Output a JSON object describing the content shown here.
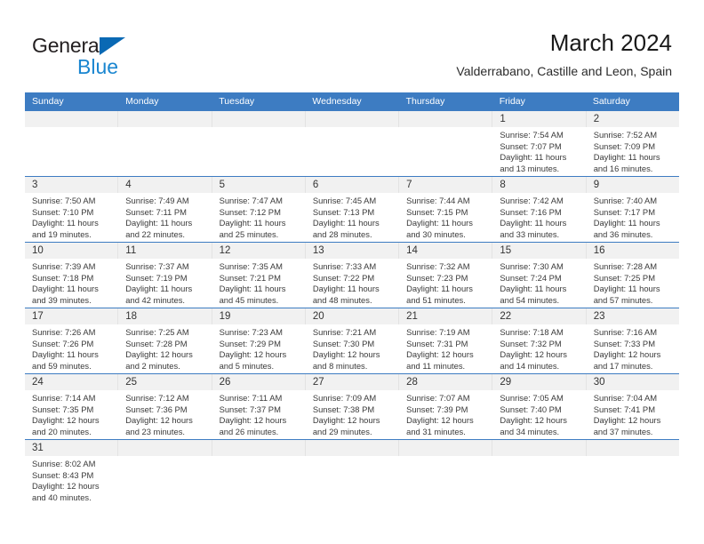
{
  "brand": {
    "name_top": "General",
    "name_bottom": "Blue",
    "color_dark": "#231f20",
    "color_blue": "#1a86d0",
    "triangle_color": "#0a69b4"
  },
  "header": {
    "title": "March 2024",
    "subtitle": "Valderrabano, Castille and Leon, Spain"
  },
  "theme": {
    "header_bar_color": "#3d7cc2",
    "daynum_band_color": "#f1f1f1",
    "row_rule_color": "#3d7cc2",
    "text_color": "#3a3a3a"
  },
  "weekdays": [
    "Sunday",
    "Monday",
    "Tuesday",
    "Wednesday",
    "Thursday",
    "Friday",
    "Saturday"
  ],
  "weeks": [
    [
      {
        "day": "",
        "lines": [
          "",
          "",
          "",
          ""
        ]
      },
      {
        "day": "",
        "lines": [
          "",
          "",
          "",
          ""
        ]
      },
      {
        "day": "",
        "lines": [
          "",
          "",
          "",
          ""
        ]
      },
      {
        "day": "",
        "lines": [
          "",
          "",
          "",
          ""
        ]
      },
      {
        "day": "",
        "lines": [
          "",
          "",
          "",
          ""
        ]
      },
      {
        "day": "1",
        "lines": [
          "Sunrise: 7:54 AM",
          "Sunset: 7:07 PM",
          "Daylight: 11 hours",
          "and 13 minutes."
        ]
      },
      {
        "day": "2",
        "lines": [
          "Sunrise: 7:52 AM",
          "Sunset: 7:09 PM",
          "Daylight: 11 hours",
          "and 16 minutes."
        ]
      }
    ],
    [
      {
        "day": "3",
        "lines": [
          "Sunrise: 7:50 AM",
          "Sunset: 7:10 PM",
          "Daylight: 11 hours",
          "and 19 minutes."
        ]
      },
      {
        "day": "4",
        "lines": [
          "Sunrise: 7:49 AM",
          "Sunset: 7:11 PM",
          "Daylight: 11 hours",
          "and 22 minutes."
        ]
      },
      {
        "day": "5",
        "lines": [
          "Sunrise: 7:47 AM",
          "Sunset: 7:12 PM",
          "Daylight: 11 hours",
          "and 25 minutes."
        ]
      },
      {
        "day": "6",
        "lines": [
          "Sunrise: 7:45 AM",
          "Sunset: 7:13 PM",
          "Daylight: 11 hours",
          "and 28 minutes."
        ]
      },
      {
        "day": "7",
        "lines": [
          "Sunrise: 7:44 AM",
          "Sunset: 7:15 PM",
          "Daylight: 11 hours",
          "and 30 minutes."
        ]
      },
      {
        "day": "8",
        "lines": [
          "Sunrise: 7:42 AM",
          "Sunset: 7:16 PM",
          "Daylight: 11 hours",
          "and 33 minutes."
        ]
      },
      {
        "day": "9",
        "lines": [
          "Sunrise: 7:40 AM",
          "Sunset: 7:17 PM",
          "Daylight: 11 hours",
          "and 36 minutes."
        ]
      }
    ],
    [
      {
        "day": "10",
        "lines": [
          "Sunrise: 7:39 AM",
          "Sunset: 7:18 PM",
          "Daylight: 11 hours",
          "and 39 minutes."
        ]
      },
      {
        "day": "11",
        "lines": [
          "Sunrise: 7:37 AM",
          "Sunset: 7:19 PM",
          "Daylight: 11 hours",
          "and 42 minutes."
        ]
      },
      {
        "day": "12",
        "lines": [
          "Sunrise: 7:35 AM",
          "Sunset: 7:21 PM",
          "Daylight: 11 hours",
          "and 45 minutes."
        ]
      },
      {
        "day": "13",
        "lines": [
          "Sunrise: 7:33 AM",
          "Sunset: 7:22 PM",
          "Daylight: 11 hours",
          "and 48 minutes."
        ]
      },
      {
        "day": "14",
        "lines": [
          "Sunrise: 7:32 AM",
          "Sunset: 7:23 PM",
          "Daylight: 11 hours",
          "and 51 minutes."
        ]
      },
      {
        "day": "15",
        "lines": [
          "Sunrise: 7:30 AM",
          "Sunset: 7:24 PM",
          "Daylight: 11 hours",
          "and 54 minutes."
        ]
      },
      {
        "day": "16",
        "lines": [
          "Sunrise: 7:28 AM",
          "Sunset: 7:25 PM",
          "Daylight: 11 hours",
          "and 57 minutes."
        ]
      }
    ],
    [
      {
        "day": "17",
        "lines": [
          "Sunrise: 7:26 AM",
          "Sunset: 7:26 PM",
          "Daylight: 11 hours",
          "and 59 minutes."
        ]
      },
      {
        "day": "18",
        "lines": [
          "Sunrise: 7:25 AM",
          "Sunset: 7:28 PM",
          "Daylight: 12 hours",
          "and 2 minutes."
        ]
      },
      {
        "day": "19",
        "lines": [
          "Sunrise: 7:23 AM",
          "Sunset: 7:29 PM",
          "Daylight: 12 hours",
          "and 5 minutes."
        ]
      },
      {
        "day": "20",
        "lines": [
          "Sunrise: 7:21 AM",
          "Sunset: 7:30 PM",
          "Daylight: 12 hours",
          "and 8 minutes."
        ]
      },
      {
        "day": "21",
        "lines": [
          "Sunrise: 7:19 AM",
          "Sunset: 7:31 PM",
          "Daylight: 12 hours",
          "and 11 minutes."
        ]
      },
      {
        "day": "22",
        "lines": [
          "Sunrise: 7:18 AM",
          "Sunset: 7:32 PM",
          "Daylight: 12 hours",
          "and 14 minutes."
        ]
      },
      {
        "day": "23",
        "lines": [
          "Sunrise: 7:16 AM",
          "Sunset: 7:33 PM",
          "Daylight: 12 hours",
          "and 17 minutes."
        ]
      }
    ],
    [
      {
        "day": "24",
        "lines": [
          "Sunrise: 7:14 AM",
          "Sunset: 7:35 PM",
          "Daylight: 12 hours",
          "and 20 minutes."
        ]
      },
      {
        "day": "25",
        "lines": [
          "Sunrise: 7:12 AM",
          "Sunset: 7:36 PM",
          "Daylight: 12 hours",
          "and 23 minutes."
        ]
      },
      {
        "day": "26",
        "lines": [
          "Sunrise: 7:11 AM",
          "Sunset: 7:37 PM",
          "Daylight: 12 hours",
          "and 26 minutes."
        ]
      },
      {
        "day": "27",
        "lines": [
          "Sunrise: 7:09 AM",
          "Sunset: 7:38 PM",
          "Daylight: 12 hours",
          "and 29 minutes."
        ]
      },
      {
        "day": "28",
        "lines": [
          "Sunrise: 7:07 AM",
          "Sunset: 7:39 PM",
          "Daylight: 12 hours",
          "and 31 minutes."
        ]
      },
      {
        "day": "29",
        "lines": [
          "Sunrise: 7:05 AM",
          "Sunset: 7:40 PM",
          "Daylight: 12 hours",
          "and 34 minutes."
        ]
      },
      {
        "day": "30",
        "lines": [
          "Sunrise: 7:04 AM",
          "Sunset: 7:41 PM",
          "Daylight: 12 hours",
          "and 37 minutes."
        ]
      }
    ],
    [
      {
        "day": "31",
        "lines": [
          "Sunrise: 8:02 AM",
          "Sunset: 8:43 PM",
          "Daylight: 12 hours",
          "and 40 minutes."
        ]
      },
      {
        "day": "",
        "lines": [
          "",
          "",
          "",
          ""
        ]
      },
      {
        "day": "",
        "lines": [
          "",
          "",
          "",
          ""
        ]
      },
      {
        "day": "",
        "lines": [
          "",
          "",
          "",
          ""
        ]
      },
      {
        "day": "",
        "lines": [
          "",
          "",
          "",
          ""
        ]
      },
      {
        "day": "",
        "lines": [
          "",
          "",
          "",
          ""
        ]
      },
      {
        "day": "",
        "lines": [
          "",
          "",
          "",
          ""
        ]
      }
    ]
  ]
}
